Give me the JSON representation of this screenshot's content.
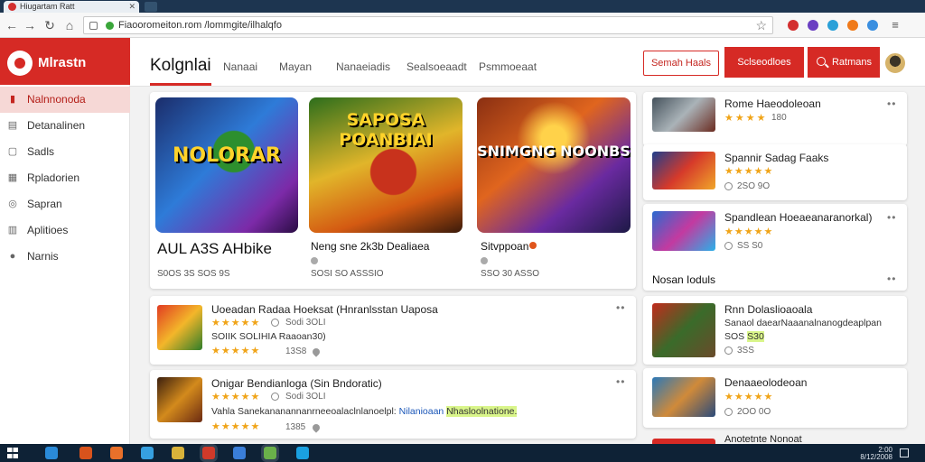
{
  "browser": {
    "tab_title": "Hiugartam Ratt",
    "url": "Fiaooromeiton.rom /lommgite/ilhalqfo",
    "extension_colors": [
      "#d32f2f",
      "#6a3fc2",
      "#2aa0d8",
      "#f07a1a",
      "#3a8fe0"
    ]
  },
  "app": {
    "brand_name": "Mlrastn",
    "accent_color": "#d62a25"
  },
  "sidebar": {
    "items": [
      {
        "label": "Nalnnonoda",
        "icon": "file-icon",
        "glyph": "▮",
        "active": true
      },
      {
        "label": "Detanalinen",
        "icon": "document-icon",
        "glyph": "▤",
        "active": false
      },
      {
        "label": "Sadls",
        "icon": "square-icon",
        "glyph": "▢",
        "active": false
      },
      {
        "label": "Rpladorien",
        "icon": "grid-icon",
        "glyph": "▦",
        "active": false
      },
      {
        "label": "Sapran",
        "icon": "circle-icon",
        "glyph": "◎",
        "active": false
      },
      {
        "label": "Aplitioes",
        "icon": "chart-icon",
        "glyph": "▥",
        "active": false
      },
      {
        "label": "Narnis",
        "icon": "chat-icon",
        "glyph": "●",
        "active": false
      }
    ]
  },
  "header": {
    "title": "Kolgnlai",
    "tabs": [
      "Nanaai",
      "Mayan",
      "Nanaeiadis",
      "Sealsoeaadt",
      "Psmmoeaat"
    ],
    "outline_button": "Semah Haals",
    "red_button": "Sclseodloes",
    "search_button": "Ratmans"
  },
  "featured": [
    {
      "art_text": "NOLORAR",
      "title": "AUL A3S AHbike",
      "sub": "S0OS 3S SOS 9S",
      "small": false
    },
    {
      "art_text": "SAPOSA POANBIAI",
      "title": "Neng sne 2k3b Dealiaea",
      "sub": "SOSI SO ASSSIO",
      "small": true
    },
    {
      "art_text": "SNIMGNG NOONBS",
      "title": "Sitvppoan",
      "sub": "SSO 30 ASSO",
      "small": true
    }
  ],
  "list": [
    {
      "title": "Uoeadan Radaa Hoeksat (Hnranlsstan Uaposa",
      "stars": "★★★★★",
      "meta1": "Sodi 3OLI",
      "line2": "SOIIK SOLIHIA Raaoan30)",
      "stars2": "★★★★★",
      "meta2": "13S8"
    },
    {
      "title": "Onigar Bendianloga (Sin Bndoratic)",
      "stars": "★★★★★",
      "meta1": "Sodi 3OLI",
      "desc_pre": "Vahla Sanekananannanrneeoalaclnlanoelpl: ",
      "desc_link": "Nilanioaan",
      "desc_hl": "Nhasloolnatione.",
      "stars2": "★★★★★",
      "meta2": "1385"
    }
  ],
  "right": {
    "top_items": [
      {
        "title": "Rome Haeodoleoan",
        "stars": "★★★★",
        "meta": "180"
      },
      {
        "title": "Spannir Sadag Faaks",
        "stars": "★★★★★",
        "meta": "2SO 9O"
      },
      {
        "title": "Spandlean Hoeaeanaranorkal)",
        "stars": "★★★★★",
        "meta": "SS S0"
      }
    ],
    "section_title": "Nosan Ioduls",
    "section_items": [
      {
        "title": "Rnn Dolaslioaoala",
        "line2": "Sanaol daearNaaanalnanogdeaplpan",
        "line3": "SOS",
        "line3_hl": "S30",
        "meta": "3SS"
      },
      {
        "title": "Denaaeolodeoan",
        "stars": "★★★★★",
        "meta": "2OO 0O"
      }
    ],
    "cut_off_title": "Anotetnte Nonoat"
  },
  "taskbar": {
    "icons": [
      {
        "name": "edge-icon",
        "color": "#2a8ad8"
      },
      {
        "name": "app-icon",
        "color": "#d8531c"
      },
      {
        "name": "folder-icon",
        "color": "#e8702a"
      },
      {
        "name": "ie-icon",
        "color": "#36a0e0"
      },
      {
        "name": "explorer-icon",
        "color": "#d8b23a"
      },
      {
        "name": "chrome-icon",
        "color": "#d03a2a"
      },
      {
        "name": "store-icon",
        "color": "#3a7ed8"
      },
      {
        "name": "game-icon",
        "color": "#6ab04a"
      },
      {
        "name": "skype-icon",
        "color": "#1aa0e0"
      }
    ],
    "time": "2:00",
    "date": "8/12/2008"
  }
}
